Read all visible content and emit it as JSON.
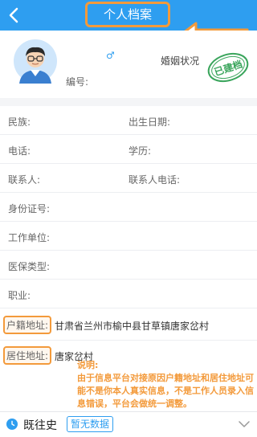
{
  "header": {
    "title": "个人档案"
  },
  "profile": {
    "gender_symbol": "♂",
    "marital_label": "婚姻状况",
    "number_label": "编号:",
    "seal_text": "已建档"
  },
  "fields": {
    "ethnicity": "民族:",
    "birth_date": "出生日期:",
    "phone": "电话:",
    "education": "学历:",
    "contact": "联系人:",
    "contact_phone": "联系人电话:",
    "id_number": "身份证号:",
    "work_unit": "工作单位:",
    "insurance": "医保类型:",
    "occupation": "职业:",
    "hukou_label": "户籍地址:",
    "hukou_value": "甘肃省兰州市榆中县甘草镇唐家岔村",
    "residence_label": "居住地址:",
    "residence_value": "唐家岔村"
  },
  "note": {
    "title": "说明:",
    "body": "由于信息平台对接原因户籍地址和居住地址可能不是你本人真实信息，不是工作人员录入信息错误，平台会做统一调整。"
  },
  "history": {
    "label": "既往史",
    "badge": "暂无数据"
  },
  "colors": {
    "primary": "#2e9ef0",
    "annotation": "#f39a3b"
  }
}
